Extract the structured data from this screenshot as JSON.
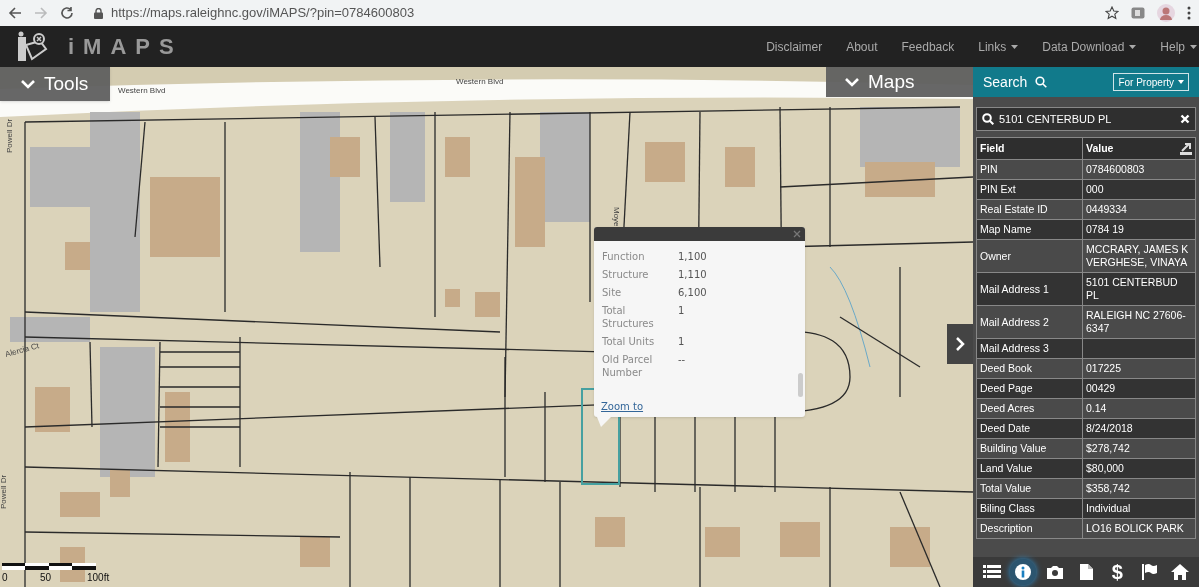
{
  "browser": {
    "url": "https://maps.raleighnc.gov/iMAPS/?pin=0784600803",
    "forward_disabled": true
  },
  "header": {
    "title": "iMAPS",
    "nav": [
      {
        "label": "Disclaimer",
        "dropdown": false
      },
      {
        "label": "About",
        "dropdown": false
      },
      {
        "label": "Feedback",
        "dropdown": false
      },
      {
        "label": "Links",
        "dropdown": true
      },
      {
        "label": "Data Download",
        "dropdown": true
      },
      {
        "label": "Help",
        "dropdown": true
      }
    ]
  },
  "map": {
    "tools_label": "Tools",
    "maps_label": "Maps",
    "street_labels": [
      {
        "text": "Western Blvd",
        "kind": "flat"
      },
      {
        "text": "Western Blvd",
        "kind": "flat"
      },
      {
        "text": "Powell Dr",
        "kind": "vertical"
      },
      {
        "text": "Alercia Ct",
        "kind": "tilted"
      },
      {
        "text": "Moye",
        "kind": "down"
      },
      {
        "text": "Powell Dr",
        "kind": "vertical"
      }
    ],
    "scale": [
      "0",
      "50",
      "100ft"
    ],
    "popup": {
      "rows": [
        {
          "label": "Function",
          "value": "1,100"
        },
        {
          "label": "Structure",
          "value": "1,110"
        },
        {
          "label": "Site",
          "value": "6,100"
        },
        {
          "label": "Total Structures",
          "value": "1"
        },
        {
          "label": "Total Units",
          "value": "1"
        },
        {
          "label": "Old Parcel Number",
          "value": "--"
        }
      ],
      "link": "Zoom to"
    }
  },
  "panel": {
    "search_label": "Search",
    "mode": "For Property",
    "query": "5101 CENTERBUD PL",
    "columns": [
      "Field",
      "Value"
    ],
    "rows": [
      {
        "field": "PIN",
        "value": "0784600803"
      },
      {
        "field": "PIN Ext",
        "value": "000"
      },
      {
        "field": "Real Estate ID",
        "value": "0449334"
      },
      {
        "field": "Map Name",
        "value": "0784 19"
      },
      {
        "field": "Owner",
        "value": "MCCRARY, JAMES K VERGHESE, VINAYA"
      },
      {
        "field": "Mail Address 1",
        "value": "5101 CENTERBUD PL"
      },
      {
        "field": "Mail Address 2",
        "value": "RALEIGH NC 27606-6347"
      },
      {
        "field": "Mail Address 3",
        "value": ""
      },
      {
        "field": "Deed Book",
        "value": "017225"
      },
      {
        "field": "Deed Page",
        "value": "00429"
      },
      {
        "field": "Deed Acres",
        "value": "0.14"
      },
      {
        "field": "Deed Date",
        "value": "8/24/2018"
      },
      {
        "field": "Building Value",
        "value": "$278,742"
      },
      {
        "field": "Land Value",
        "value": "$80,000"
      },
      {
        "field": "Total Value",
        "value": "$358,742"
      },
      {
        "field": "Biling Class",
        "value": "Individual"
      },
      {
        "field": "Description",
        "value": "LO16 BOLICK PARK"
      }
    ],
    "toolbar": [
      {
        "kind": "list",
        "selected": false
      },
      {
        "kind": "info",
        "selected": true
      },
      {
        "kind": "camera",
        "selected": false
      },
      {
        "kind": "document",
        "selected": false
      },
      {
        "kind": "glyph",
        "glyph": "$",
        "selected": false
      },
      {
        "kind": "flag",
        "selected": false
      },
      {
        "kind": "home",
        "selected": false
      }
    ]
  }
}
